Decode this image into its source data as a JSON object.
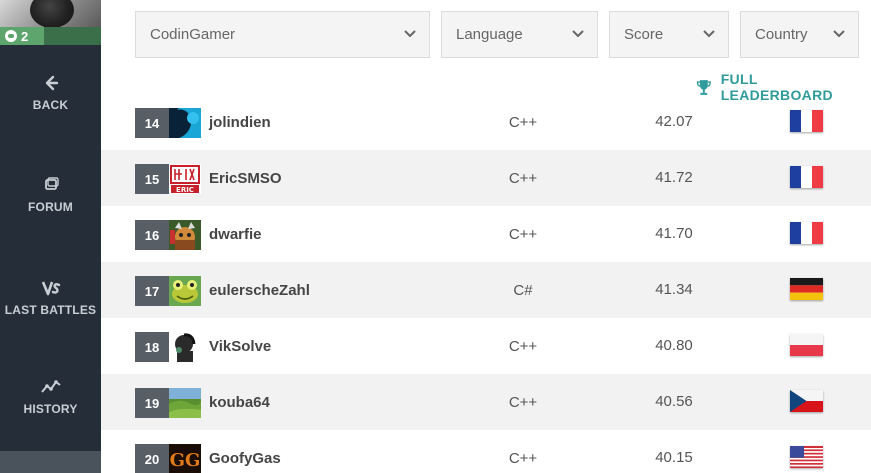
{
  "sidebar": {
    "level": "2",
    "nav": [
      {
        "label": "BACK",
        "icon": "arrow-left-icon"
      },
      {
        "label": "FORUM",
        "icon": "forum-icon"
      },
      {
        "label": "LAST BATTLES",
        "icon": "vs-icon"
      },
      {
        "label": "HISTORY",
        "icon": "history-icon"
      }
    ]
  },
  "filters": {
    "codingamer": "CodinGamer",
    "language": "Language",
    "score": "Score",
    "country": "Country"
  },
  "full_leaderboard": {
    "label": "FULL LEADERBOARD",
    "icon": "trophy-icon"
  },
  "rows": [
    {
      "rank": "14",
      "name": "jolindien",
      "language": "C++",
      "score": "42.07",
      "country": "france"
    },
    {
      "rank": "15",
      "name": "EricSMSO",
      "language": "C++",
      "score": "41.72",
      "country": "france"
    },
    {
      "rank": "16",
      "name": "dwarfie",
      "language": "C++",
      "score": "41.70",
      "country": "france"
    },
    {
      "rank": "17",
      "name": "eulerscheZahl",
      "language": "C#",
      "score": "41.34",
      "country": "germany"
    },
    {
      "rank": "18",
      "name": "VikSolve",
      "language": "C++",
      "score": "40.80",
      "country": "poland"
    },
    {
      "rank": "19",
      "name": "kouba64",
      "language": "C++",
      "score": "40.56",
      "country": "czech-republic"
    },
    {
      "rank": "20",
      "name": "GoofyGas",
      "language": "C++",
      "score": "40.15",
      "country": "united-states"
    }
  ],
  "colors": {
    "sidebar": "#252e38",
    "accent": "#2f9c9b",
    "level_green": "#5ea56d",
    "rank_badge": "#585e66"
  }
}
